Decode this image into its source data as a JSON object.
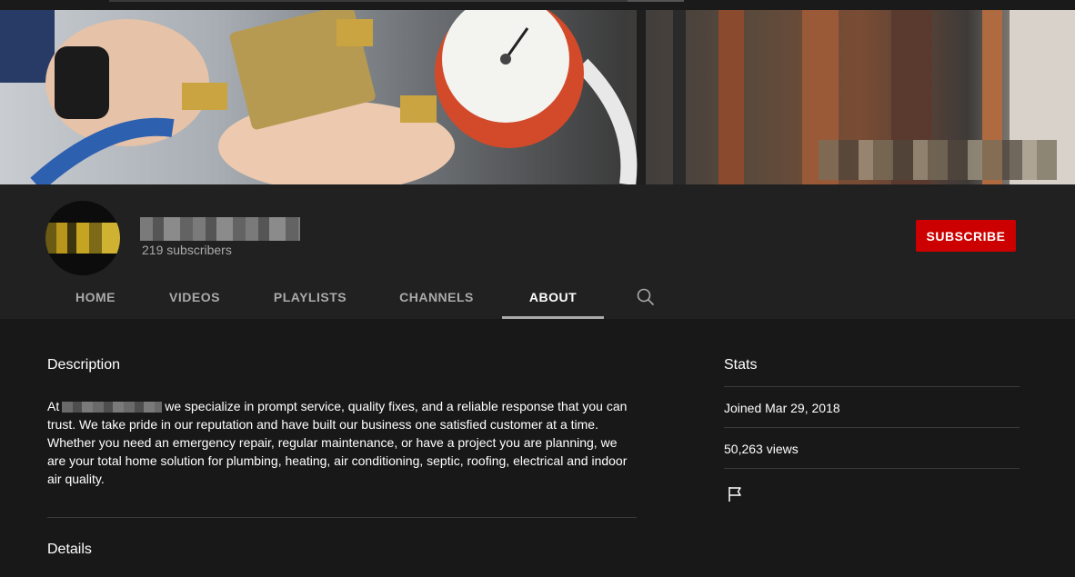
{
  "channel": {
    "subscribers": "219 subscribers",
    "subscribe_label": "SUBSCRIBE"
  },
  "tabs": [
    {
      "label": "HOME"
    },
    {
      "label": "VIDEOS"
    },
    {
      "label": "PLAYLISTS"
    },
    {
      "label": "CHANNELS"
    },
    {
      "label": "ABOUT",
      "active": true
    }
  ],
  "icons": {
    "search": "search-icon",
    "flag": "flag-icon"
  },
  "about": {
    "description_title": "Description",
    "description_prefix": "At",
    "description_text": "we specialize in prompt service, quality fixes, and a reliable response that you can trust. We take pride in our reputation and have built our business one satisfied customer at a time. Whether you need an emergency repair, regular maintenance, or have a project you are planning, we are your total home solution for plumbing, heating, air conditioning, septic, roofing, electrical and indoor air quality.",
    "details_title": "Details"
  },
  "stats": {
    "title": "Stats",
    "joined": "Joined Mar 29, 2018",
    "views": "50,263 views"
  },
  "colors": {
    "subscribe": "#cc0000",
    "header_bg": "#212121",
    "content_bg": "#181818",
    "inactive_tab": "#aaaaaa"
  }
}
